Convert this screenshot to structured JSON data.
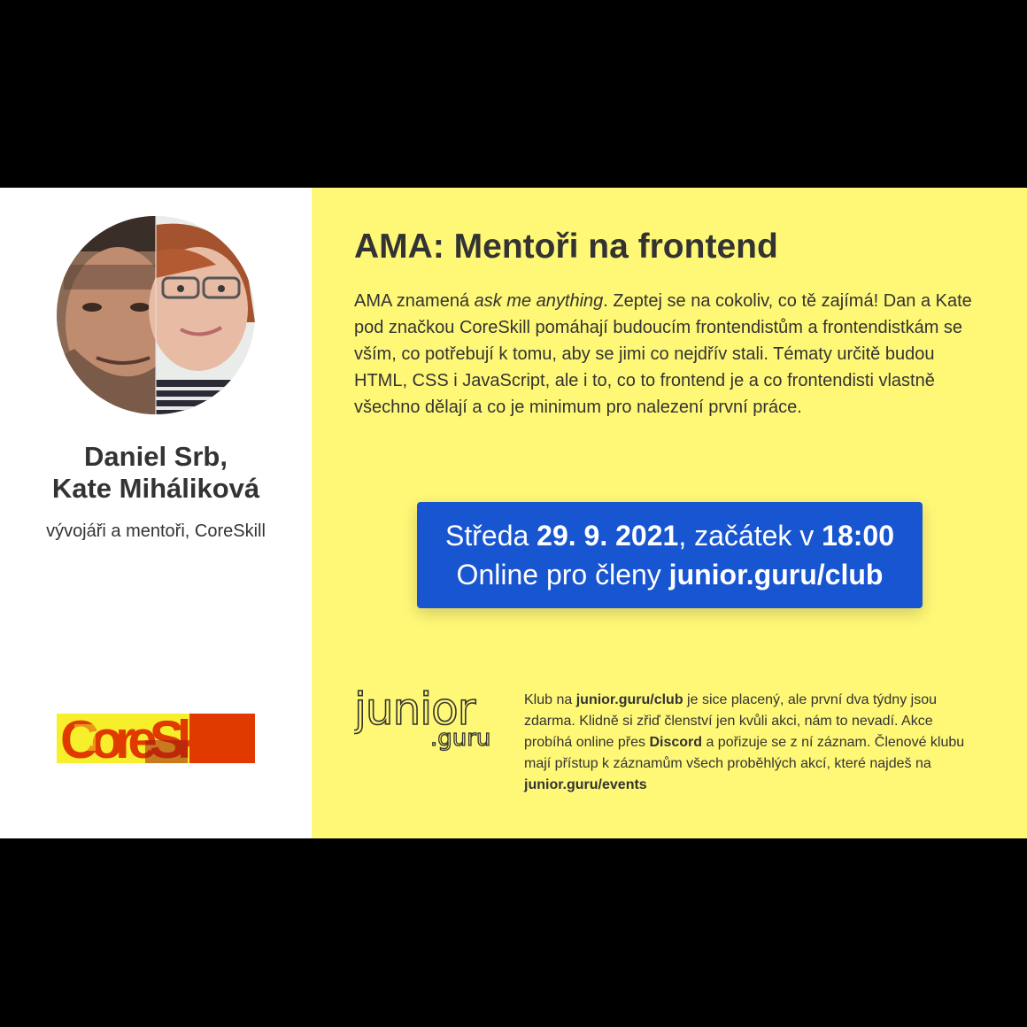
{
  "speakers": {
    "names_line1": "Daniel Srb,",
    "names_line2": "Kate Miháliková",
    "roles": "vývojáři a mentoři, CoreSkill"
  },
  "logos": {
    "coreskill": "CoreSkill",
    "juniorguru_main": "junior",
    "juniorguru_sub": ".guru"
  },
  "event": {
    "title": "AMA: Mentoři na frontend",
    "desc_pre": "AMA znamená ",
    "desc_em": "ask me anything",
    "desc_post": ". Zeptej se na cokoliv, co tě zajímá! Dan a Kate pod značkou CoreSkill pomáhají budoucím frontendistům a frontendistkám se vším, co potřebují k tomu, aby se jimi co nejdřív stali. Tématy určitě budou HTML, CSS i JavaScript, ale i to, co to frontend je a co frontendisti vlastně všechno dělají a co je minimum pro nalezení první práce."
  },
  "datebox": {
    "day": "Středa ",
    "date": "29. 9. 2021",
    "mid": ", začátek v ",
    "time": "18:00",
    "online": "Online pro členy ",
    "url": "junior.guru/club"
  },
  "club": {
    "t1": "Klub na ",
    "b1": "junior.guru/club",
    "t2": " je sice placený, ale první dva týdny jsou zdarma. Klidně si zřiď členství jen kvůli akci, nám to nevadí. Akce probíhá online přes ",
    "b2": "Discord",
    "t3": " a pořizuje se z ní záznam. Členové klubu mají přístup k záznamům všech proběhlých akcí, které najdeš na ",
    "b3": "junior.guru/events"
  },
  "colors": {
    "panel_yellow": "#fff877",
    "button_blue": "#1755d1",
    "coreskill_orange": "#e03a00",
    "coreskill_yellow": "#f7ef2c",
    "coreskill_darkred": "#a11a14"
  }
}
